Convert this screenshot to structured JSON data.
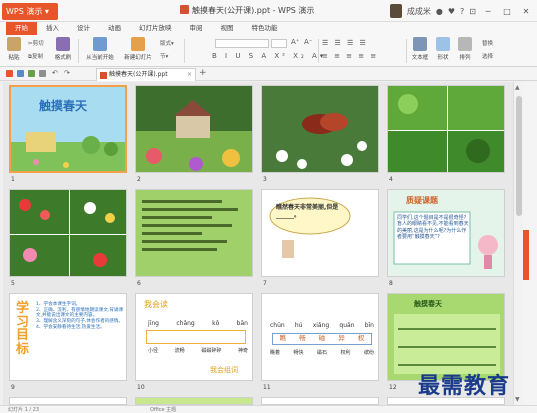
{
  "app": {
    "name": "WPS 演示",
    "colors": {
      "accent": "#e8552a",
      "slide_selected": "#f2a14a"
    }
  },
  "title": {
    "document": "触摸春天(公开课).ppt - WPS 演示",
    "user": "成成米"
  },
  "menu": {
    "tabs": [
      "开始",
      "插入",
      "设计",
      "动画",
      "幻灯片放映",
      "审阅",
      "视图",
      "特色功能"
    ]
  },
  "ribbon": {
    "paste": "粘贴",
    "cut": "剪切",
    "copy": "复制",
    "format_painter": "格式刷",
    "from_current": "从当前开始",
    "new_slide": "新建幻灯片",
    "layout": "版式",
    "section": "节",
    "textbox": "文本框",
    "shape": "形状",
    "arrange": "排列",
    "replace": "替换",
    "select": "选择"
  },
  "doc_tab": {
    "name": "触摸春天(公开课).ppt"
  },
  "slides": [
    {
      "num": "1",
      "title": "触摸春天"
    },
    {
      "num": "2"
    },
    {
      "num": "3"
    },
    {
      "num": "4"
    },
    {
      "num": "5"
    },
    {
      "num": "6"
    },
    {
      "num": "7",
      "bubble": "瞧然春天非常美丽,但是______。"
    },
    {
      "num": "8",
      "heading": "质疑课题",
      "body": "同学们,这个题目是不是很奇怪?盲人的眼睛看不见,不能看到春天的美丽,这是为什么呢?为什么作者要用“触摸春天”?"
    },
    {
      "num": "9",
      "side": "学习目标",
      "goals": [
        "1、学会本课生字词。",
        "2、正确、流利、有感情地朗读课文,背诵课文,并能说出课文的主要内容。",
        "3、理解含义深刻的句子,体会作者的感情。",
        "4、学会安静看待生活,热爱生活。"
      ]
    },
    {
      "num": "10",
      "title": "我会读",
      "pinyin": [
        "jīng",
        "chǎng",
        "kǒ",
        "bān"
      ],
      "words": [
        "小径",
        "流畅",
        "磁磁碎碎",
        "神奇"
      ],
      "footer": "我会组词"
    },
    {
      "num": "11",
      "pinyin": [
        "chūn",
        "hú",
        "xiǎng",
        "quān",
        "bīn"
      ],
      "chars": [
        "瞧",
        "畅",
        "磁",
        "异",
        "权"
      ],
      "words": [
        "瞧着",
        "畅快",
        "磁石",
        "权利",
        "缤纷"
      ]
    },
    {
      "num": "12",
      "title": "触摸春天"
    }
  ],
  "status": {
    "page": "幻灯片 1 / 23",
    "theme": "Office 主题"
  },
  "watermark": "最需教育"
}
